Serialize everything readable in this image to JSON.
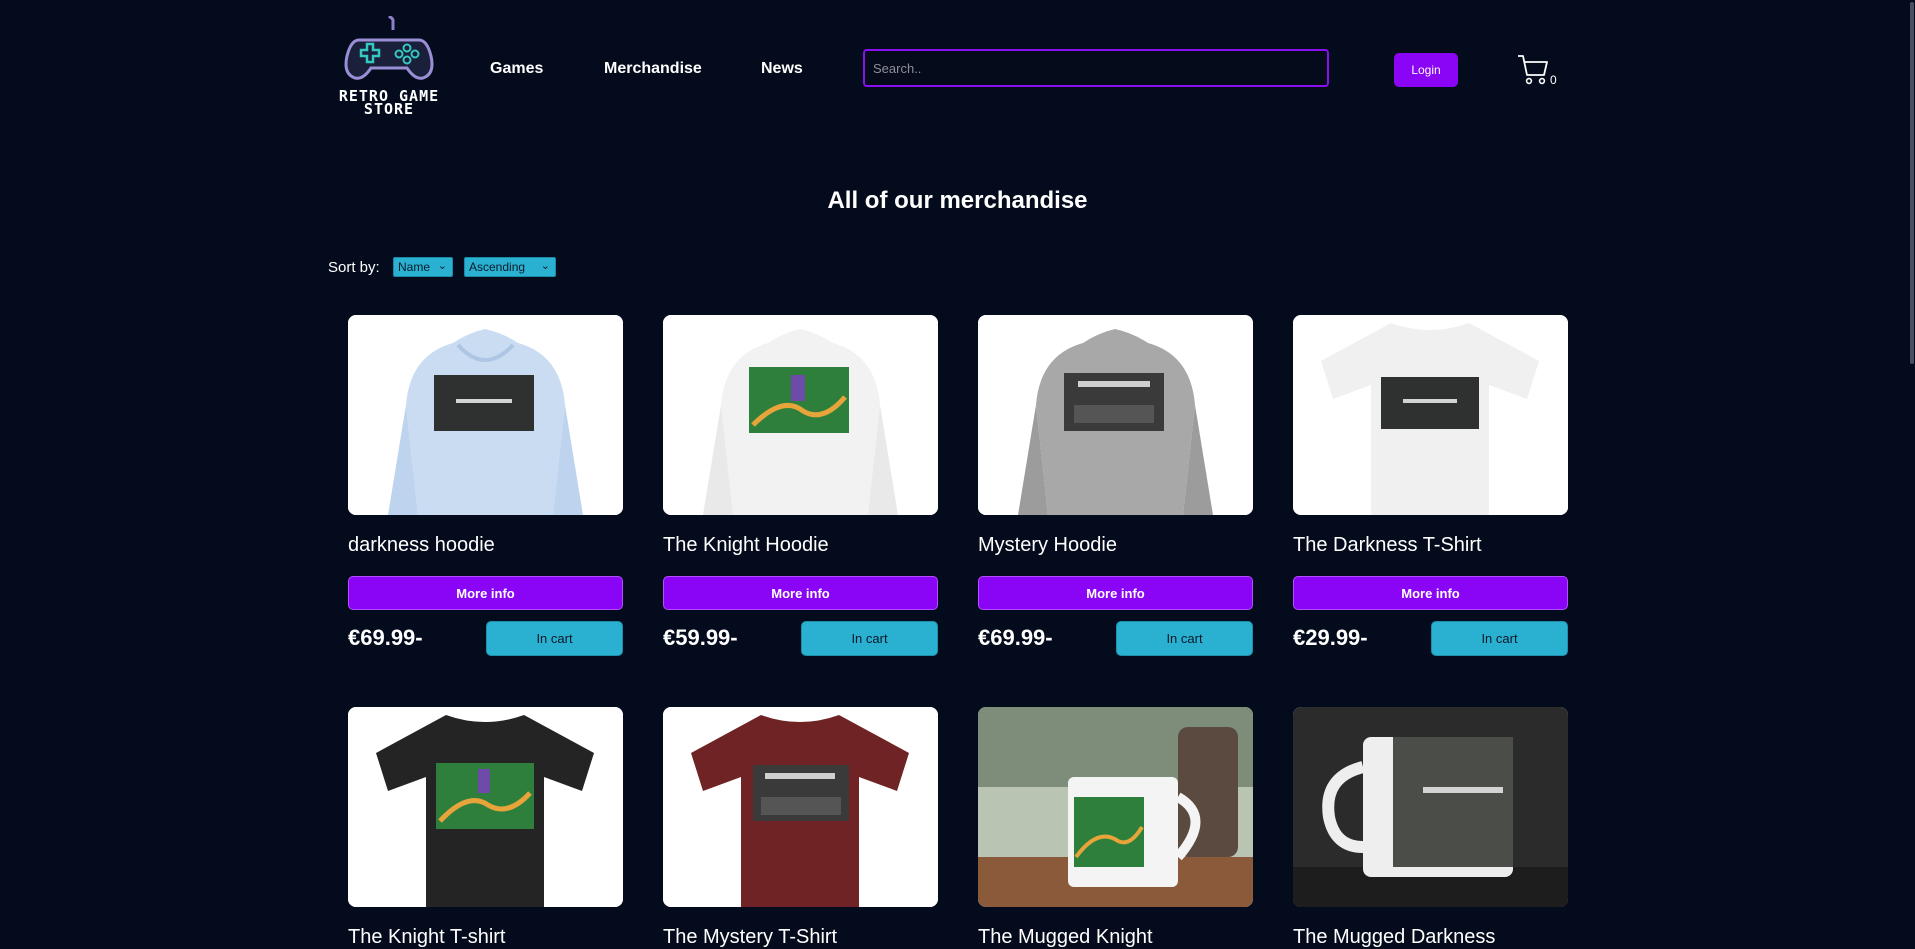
{
  "logo": {
    "line1": "RETRO GAME",
    "line2": "STORE"
  },
  "nav": [
    {
      "label": "Games"
    },
    {
      "label": "Merchandise"
    },
    {
      "label": "News"
    }
  ],
  "search": {
    "placeholder": "Search..",
    "value": ""
  },
  "login_label": "Login",
  "cart": {
    "count": "0"
  },
  "page_title": "All of our merchandise",
  "sort": {
    "label": "Sort by:",
    "field": "Name",
    "order": "Ascending"
  },
  "products": [
    {
      "name": "darkness hoodie",
      "price": "€69.99-",
      "more_label": "More info",
      "cart_label": "In cart"
    },
    {
      "name": "The Knight Hoodie",
      "price": "€59.99-",
      "more_label": "More info",
      "cart_label": "In cart"
    },
    {
      "name": "Mystery Hoodie",
      "price": "€69.99-",
      "more_label": "More info",
      "cart_label": "In cart"
    },
    {
      "name": "The Darkness T-Shirt",
      "price": "€29.99-",
      "more_label": "More info",
      "cart_label": "In cart"
    },
    {
      "name": "The Knight T-shirt"
    },
    {
      "name": "The Mystery T-Shirt"
    },
    {
      "name": "The Mugged Knight"
    },
    {
      "name": "The Mugged Darkness"
    }
  ],
  "colors": {
    "background": "#040b1c",
    "accent_purple": "#8a05f5",
    "accent_cyan": "#2ab1d2"
  }
}
